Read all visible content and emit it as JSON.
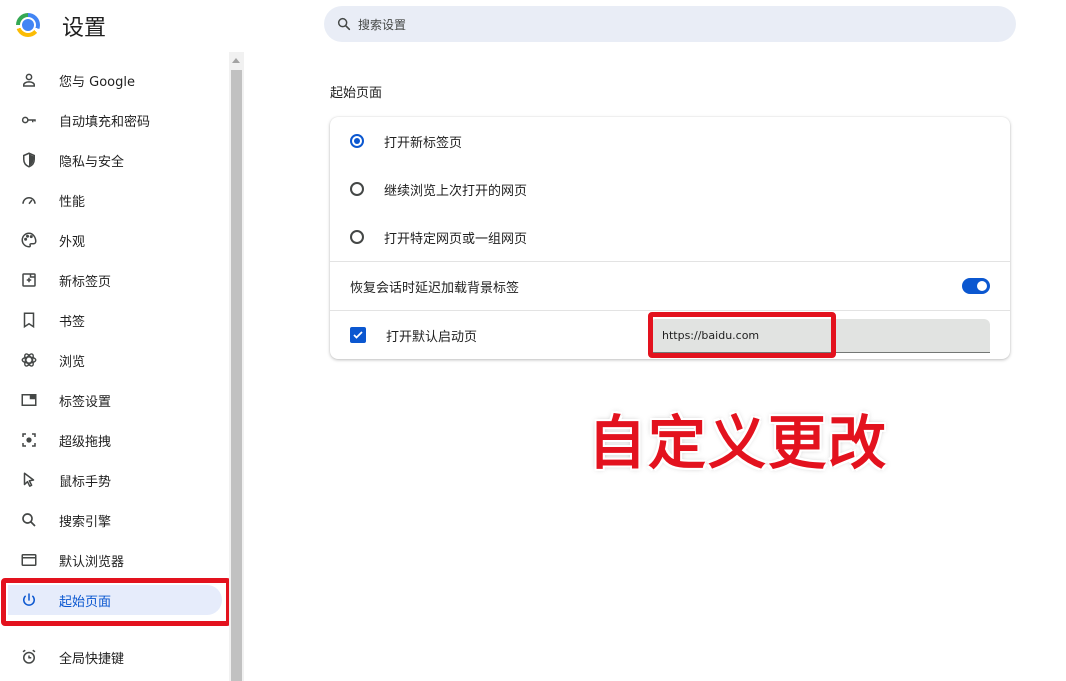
{
  "app": {
    "title": "设置"
  },
  "search": {
    "placeholder": "搜索设置"
  },
  "sidebar": {
    "items": [
      {
        "label": "您与 Google",
        "icon": "person-icon"
      },
      {
        "label": "自动填充和密码",
        "icon": "key-icon"
      },
      {
        "label": "隐私与安全",
        "icon": "shield-icon"
      },
      {
        "label": "性能",
        "icon": "speedometer-icon"
      },
      {
        "label": "外观",
        "icon": "palette-icon"
      },
      {
        "label": "新标签页",
        "icon": "new-tab-icon"
      },
      {
        "label": "书签",
        "icon": "bookmark-icon"
      },
      {
        "label": "浏览",
        "icon": "atom-icon"
      },
      {
        "label": "标签设置",
        "icon": "tab-window-icon"
      },
      {
        "label": "超级拖拽",
        "icon": "drag-target-icon"
      },
      {
        "label": "鼠标手势",
        "icon": "cursor-icon"
      },
      {
        "label": "搜索引擎",
        "icon": "search-icon"
      },
      {
        "label": "默认浏览器",
        "icon": "browser-window-icon"
      },
      {
        "label": "起始页面",
        "icon": "power-icon",
        "active": true
      },
      {
        "label": "全局快捷键",
        "icon": "alarm-clock-icon"
      }
    ]
  },
  "main": {
    "section_title": "起始页面",
    "options": [
      {
        "label": "打开新标签页",
        "selected": true
      },
      {
        "label": "继续浏览上次打开的网页",
        "selected": false
      },
      {
        "label": "打开特定网页或一组网页",
        "selected": false
      }
    ],
    "restore_toggle": {
      "label": "恢复会话时延迟加载背景标签",
      "on": true
    },
    "default_startup": {
      "label": "打开默认启动页",
      "checked": true,
      "url_value": "https://baidu.com"
    }
  },
  "annotation": {
    "text": "自定义更改",
    "color": "#e3121e"
  },
  "colors": {
    "accent": "#0b57d0",
    "highlight": "#e3121e"
  }
}
